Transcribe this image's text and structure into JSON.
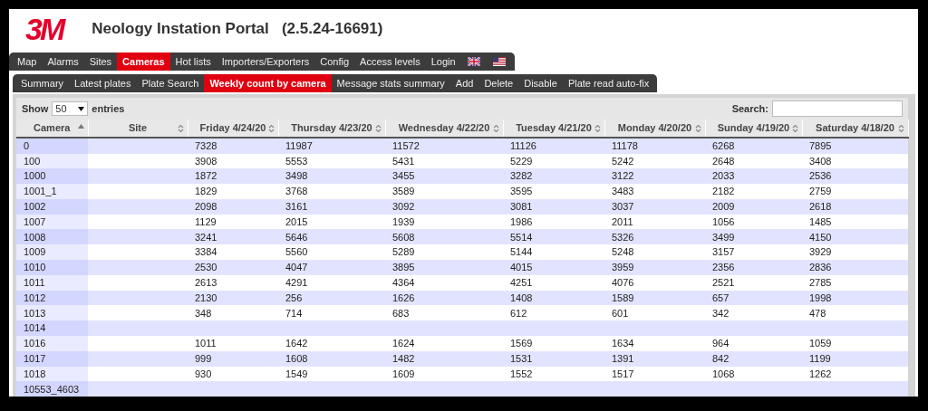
{
  "header": {
    "logo": "3M",
    "title": "Neology Instation Portal   (2.5.24-16691)"
  },
  "main_nav": [
    {
      "label": "Map",
      "selected": false
    },
    {
      "label": "Alarms",
      "selected": false
    },
    {
      "label": "Sites",
      "selected": false
    },
    {
      "label": "Cameras",
      "selected": true
    },
    {
      "label": "Hot lists",
      "selected": false
    },
    {
      "label": "Importers/Exporters",
      "selected": false
    },
    {
      "label": "Config",
      "selected": false
    },
    {
      "label": "Access levels",
      "selected": false
    },
    {
      "label": "Login",
      "selected": false
    }
  ],
  "sub_nav": [
    {
      "label": "Summary",
      "selected": false
    },
    {
      "label": "Latest plates",
      "selected": false
    },
    {
      "label": "Plate Search",
      "selected": false
    },
    {
      "label": "Weekly count by camera",
      "selected": true
    },
    {
      "label": "Message stats summary",
      "selected": false
    },
    {
      "label": "Add",
      "selected": false
    },
    {
      "label": "Delete",
      "selected": false
    },
    {
      "label": "Disable",
      "selected": false
    },
    {
      "label": "Plate read auto-fix",
      "selected": false
    }
  ],
  "table_controls": {
    "show_label": "Show",
    "page_size": "50",
    "entries_label": "entries",
    "search_label": "Search:"
  },
  "table": {
    "columns": [
      {
        "label": "Camera",
        "sorted": true
      },
      {
        "label": "Site",
        "sorted": false
      },
      {
        "label": "Friday 4/24/20",
        "sorted": false
      },
      {
        "label": "Thursday 4/23/20",
        "sorted": false
      },
      {
        "label": "Wednesday 4/22/20",
        "sorted": false
      },
      {
        "label": "Tuesday 4/21/20",
        "sorted": false
      },
      {
        "label": "Monday 4/20/20",
        "sorted": false
      },
      {
        "label": "Sunday 4/19/20",
        "sorted": false
      },
      {
        "label": "Saturday 4/18/20",
        "sorted": false
      }
    ],
    "rows": [
      {
        "camera": "0",
        "counts": [
          "7328",
          "11987",
          "11572",
          "11126",
          "11178",
          "6268",
          "7895"
        ]
      },
      {
        "camera": "100",
        "counts": [
          "3908",
          "5553",
          "5431",
          "5229",
          "5242",
          "2648",
          "3408"
        ]
      },
      {
        "camera": "1000",
        "counts": [
          "1872",
          "3498",
          "3455",
          "3282",
          "3122",
          "2033",
          "2536"
        ]
      },
      {
        "camera": "1001_1",
        "counts": [
          "1829",
          "3768",
          "3589",
          "3595",
          "3483",
          "2182",
          "2759"
        ]
      },
      {
        "camera": "1002",
        "counts": [
          "2098",
          "3161",
          "3092",
          "3081",
          "3037",
          "2009",
          "2618"
        ]
      },
      {
        "camera": "1007",
        "counts": [
          "1129",
          "2015",
          "1939",
          "1986",
          "2011",
          "1056",
          "1485"
        ]
      },
      {
        "camera": "1008",
        "counts": [
          "3241",
          "5646",
          "5608",
          "5514",
          "5326",
          "3499",
          "4150"
        ]
      },
      {
        "camera": "1009",
        "counts": [
          "3384",
          "5560",
          "5289",
          "5144",
          "5248",
          "3157",
          "3929"
        ]
      },
      {
        "camera": "1010",
        "counts": [
          "2530",
          "4047",
          "3895",
          "4015",
          "3959",
          "2356",
          "2836"
        ]
      },
      {
        "camera": "1011",
        "counts": [
          "2613",
          "4291",
          "4364",
          "4251",
          "4076",
          "2521",
          "2785"
        ]
      },
      {
        "camera": "1012",
        "counts": [
          "2130",
          "256",
          "1626",
          "1408",
          "1589",
          "657",
          "1998"
        ]
      },
      {
        "camera": "1013",
        "counts": [
          "348",
          "714",
          "683",
          "612",
          "601",
          "342",
          "478"
        ]
      },
      {
        "camera": "1014"
      },
      {
        "camera": "1016",
        "counts": [
          "1011",
          "1642",
          "1624",
          "1569",
          "1634",
          "964",
          "1059"
        ]
      },
      {
        "camera": "1017",
        "counts": [
          "999",
          "1608",
          "1482",
          "1531",
          "1391",
          "842",
          "1199"
        ]
      },
      {
        "camera": "1018",
        "counts": [
          "930",
          "1549",
          "1609",
          "1552",
          "1517",
          "1068",
          "1262"
        ]
      },
      {
        "camera": "10553_4603"
      }
    ]
  }
}
